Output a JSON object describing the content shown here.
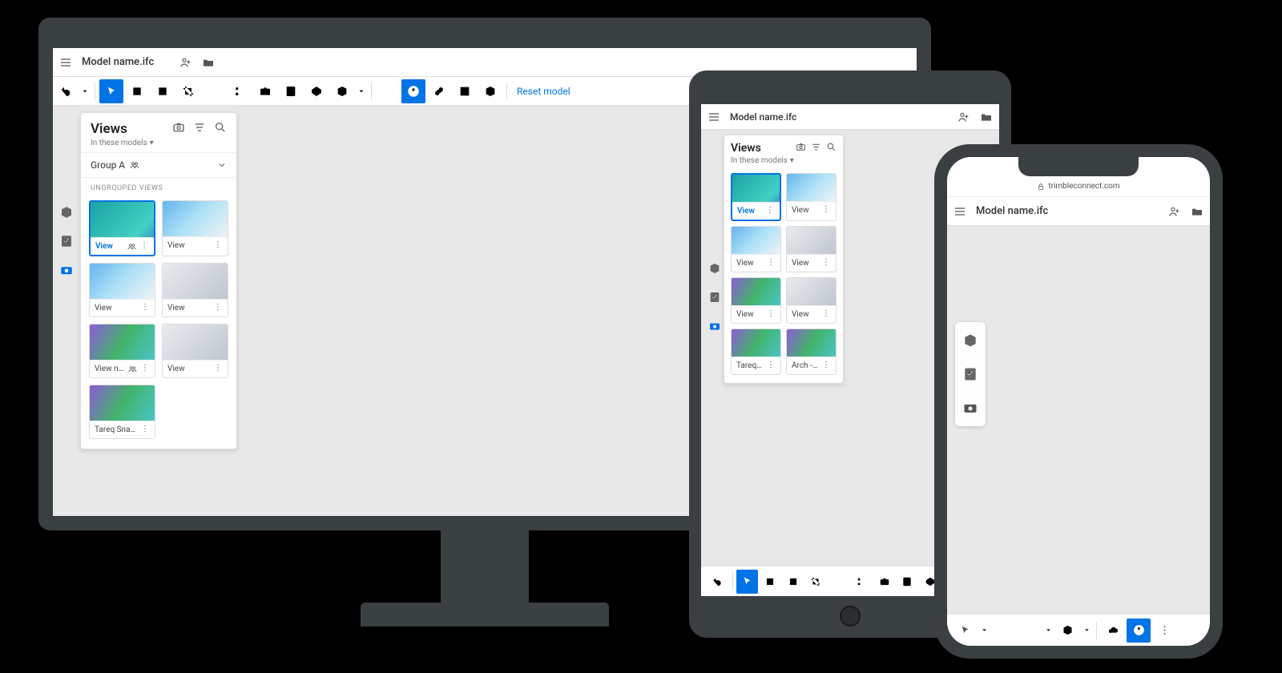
{
  "header": {
    "model_name": "Model name.ifc"
  },
  "toolbar": {
    "reset_label": "Reset model"
  },
  "views_panel": {
    "title": "Views",
    "subtitle": "In these models",
    "group_label": "Group A",
    "section_label": "UNGROUPED VIEWS"
  },
  "desktop_views": [
    {
      "name": "View",
      "selected": true,
      "shared": true
    },
    {
      "name": "View"
    },
    {
      "name": "View"
    },
    {
      "name": "View"
    },
    {
      "name": "View na...",
      "shared": true
    },
    {
      "name": "View"
    },
    {
      "name": "Tareq Snap..."
    }
  ],
  "tablet_views": [
    {
      "name": "View",
      "selected": true
    },
    {
      "name": "View"
    },
    {
      "name": "View"
    },
    {
      "name": "View"
    },
    {
      "name": "View"
    },
    {
      "name": "View"
    },
    {
      "name": "Tareq Snap..."
    },
    {
      "name": "Arch - Horiz..."
    }
  ],
  "phone": {
    "url": "trimbleconnect.com"
  }
}
